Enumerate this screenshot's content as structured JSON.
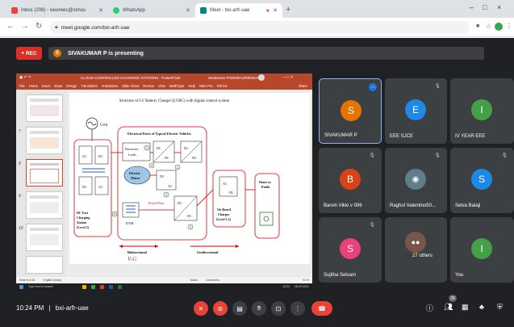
{
  "browser": {
    "tabs": [
      {
        "title": "Inbox (208) - iveerees@ximou",
        "color": "#ea4335"
      },
      {
        "title": "WhatsApp",
        "color": "#25d366"
      },
      {
        "title": "Meet - bxi-arfr-uae",
        "color": "#00897b"
      }
    ],
    "new_tab": "+",
    "window": {
      "minimize": "–",
      "maximize": "□",
      "close": "×"
    },
    "url": "meet.google.com/bxi-arfr-uae"
  },
  "meet": {
    "rec_label": "REC",
    "presenter_initial": "S",
    "presenting_text": "SIVAKUMAR P is presenting",
    "clock": "10:24 PM",
    "separator": "|",
    "meeting_code": "bxi-arfr-uae",
    "people_count": "28",
    "participants": [
      {
        "name": "SIVAKUMAR P",
        "initial": "S",
        "color": "#e37400"
      },
      {
        "name": "EEE SJCE",
        "initial": "E",
        "color": "#1e88e5"
      },
      {
        "name": "IV YEAR EEE",
        "initial": "I",
        "color": "#43a047"
      },
      {
        "name": "Barvin Vikki v 006",
        "initial": "B",
        "color": "#d84315"
      },
      {
        "name": "Raghul Valentino50...",
        "initial": "",
        "color": "#607d8b"
      },
      {
        "name": "Selva Balaji",
        "initial": "S",
        "color": "#1e88e5"
      },
      {
        "name": "Sujitha Selvam",
        "initial": "S",
        "color": "#ec407a"
      },
      {
        "name": "27 others",
        "initial": "",
        "color": "#795548"
      },
      {
        "name": "You",
        "initial": "I",
        "color": "#43a047"
      }
    ]
  },
  "ppt": {
    "title": "CLOUD CONTROLLED CHARGING STATIONS - PowerPoint",
    "user": "Sivakumar POONRAJ/RENGAN",
    "menu": [
      "File",
      "Home",
      "Insert",
      "Draw",
      "Design",
      "Transitions",
      "Animations",
      "Slide Show",
      "Review",
      "View",
      "MathType",
      "Help",
      "Nitro Pro",
      "Tell me"
    ],
    "share": "Share",
    "slide_title": "Structure of LV Battery Charger (LVBC) with digital control system",
    "diagram": {
      "grid": "Grid",
      "ac": "AC",
      "dc": "DC",
      "panel_title": "Electrical Parts of Typical Electric Vehicles",
      "loads": "Electronic Loads",
      "motor": "Electric Motor",
      "power_flow": "Power Flow",
      "evb": "EVB",
      "dc_fast": "DC Fast Charging Station (Level 3)",
      "onboard": "On Board Charger (Level 1,2)",
      "home": "Home or Public",
      "bidirectional": "Bidirectional",
      "unidirectional": "Unidirectional",
      "handwriting": "V-G"
    },
    "thumb_numbers": [
      "7",
      "8",
      "9",
      "10"
    ],
    "status": {
      "slide": "Slide 8 of 46",
      "lang": "English (India)",
      "notes": "Notes",
      "comments": "Comments",
      "zoom": "91 %"
    },
    "taskbar": {
      "search": "Type here to search",
      "time": "22:24",
      "date": "28-09-2021"
    }
  },
  "icons": {
    "back": "back-arrow-icon",
    "forward": "forward-arrow-icon",
    "reload": "reload-icon"
  }
}
